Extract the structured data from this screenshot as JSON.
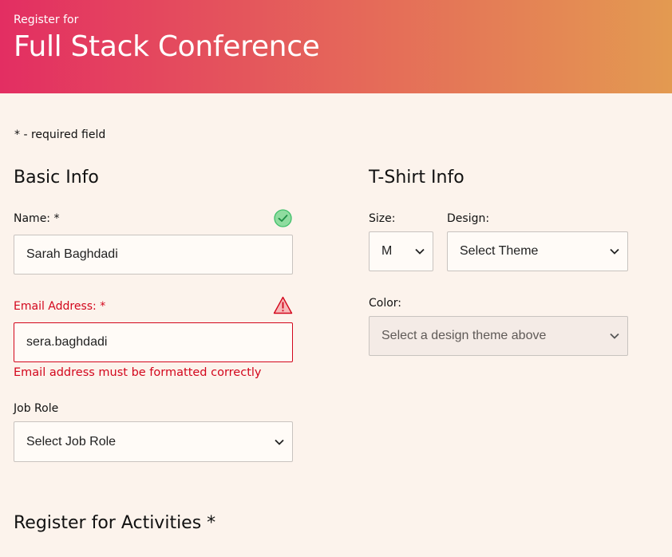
{
  "header": {
    "pre_title": "Register for",
    "title": "Full Stack Conference"
  },
  "required_note": "* - required field",
  "basic_info": {
    "title": "Basic Info",
    "name": {
      "label": "Name: *",
      "value": "Sarah Baghdadi",
      "status_icon": "check-circle-icon"
    },
    "email": {
      "label": "Email Address: *",
      "value": "sera.baghdadi",
      "status_icon": "warning-triangle-icon",
      "error": "Email address must be formatted correctly"
    },
    "job_role": {
      "label": "Job Role",
      "selected": "Select Job Role"
    }
  },
  "tshirt_info": {
    "title": "T-Shirt Info",
    "size": {
      "label": "Size:",
      "selected": "M"
    },
    "design": {
      "label": "Design:",
      "selected": "Select Theme"
    },
    "color": {
      "label": "Color:",
      "selected": "Select a design theme above"
    }
  },
  "activities": {
    "title": "Register for Activities *"
  },
  "colors": {
    "error": "#d3061c",
    "success": "#3fbf6a",
    "page_background": "#fcf3ec",
    "header_gradient_start": "#e32e62",
    "header_gradient_end": "#e39a51"
  }
}
